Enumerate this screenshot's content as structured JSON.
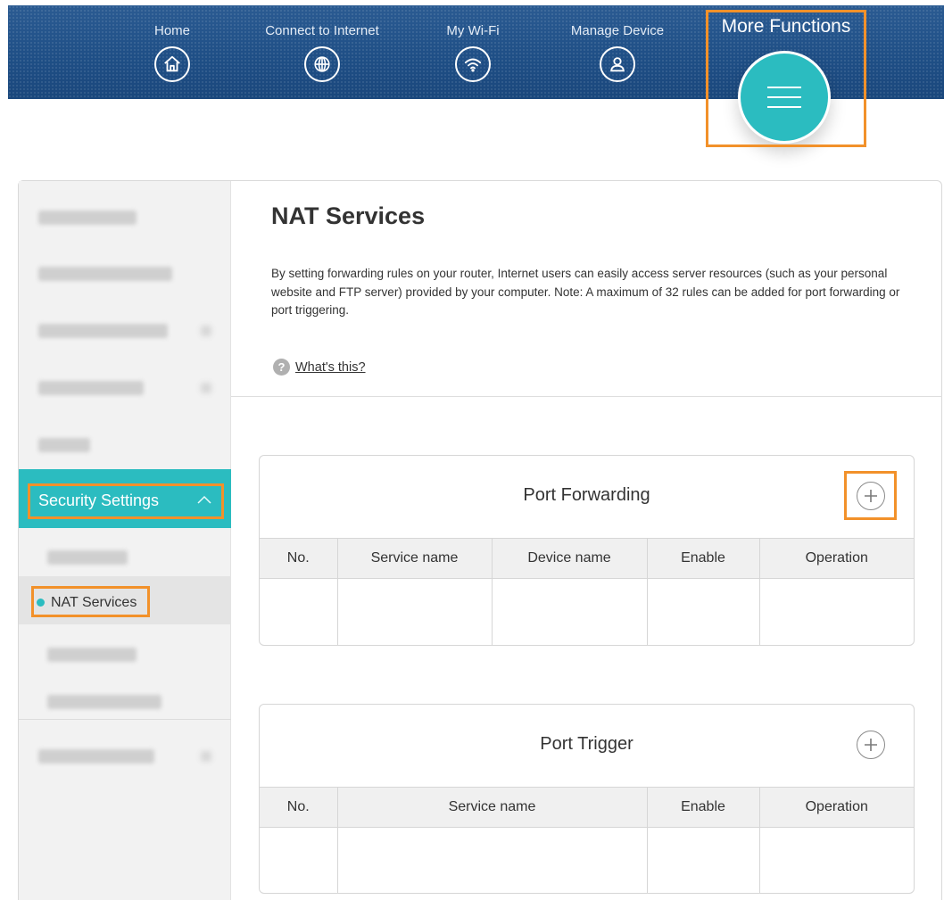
{
  "nav": {
    "items": [
      {
        "label": "Home",
        "icon": "home-icon"
      },
      {
        "label": "Connect to Internet",
        "icon": "globe-icon"
      },
      {
        "label": "My Wi-Fi",
        "icon": "wifi-icon"
      },
      {
        "label": "Manage Device",
        "icon": "user-icon"
      }
    ],
    "more_label": "More Functions",
    "more_icon": "menu-icon"
  },
  "sidebar": {
    "active_section": "Security Settings",
    "active_subitem": "NAT Services"
  },
  "page": {
    "title": "NAT Services",
    "description": "By setting forwarding rules on your router, Internet users can easily access server resources (such as your personal website and FTP server) provided by your computer. Note: A maximum of 32 rules can be added for port forwarding or port triggering.",
    "help_link": "What's this?"
  },
  "port_forwarding": {
    "title": "Port Forwarding",
    "columns": [
      "No.",
      "Service name",
      "Device name",
      "Enable",
      "Operation"
    ]
  },
  "port_trigger": {
    "title": "Port Trigger",
    "columns": [
      "No.",
      "Service name",
      "Enable",
      "Operation"
    ]
  },
  "colors": {
    "accent": "#2bbcc0",
    "highlight": "#f2912a",
    "header": "#1f4f86"
  }
}
